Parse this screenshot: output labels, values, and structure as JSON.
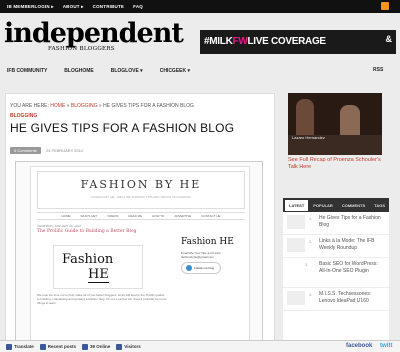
{
  "topbar": {
    "items": [
      "IB MEMBERLOGIN ▸",
      "ABOUT ▸",
      "CONTRIBUTE",
      "FAQ"
    ]
  },
  "logo": {
    "name": "independent",
    "tagline": "FASHION BLOGGERS"
  },
  "banner": {
    "hashtag_prefix": "#MILK",
    "hashtag_accent": "FW",
    "hashtag_rest": "LIVE COVERAGE",
    "brand": "&"
  },
  "mainnav": {
    "items": [
      "IFB COMMUNITY",
      "BLOGHOME",
      "BLOGLOVE ▾",
      "CHICGEEK ▾"
    ],
    "rss": "RSS"
  },
  "breadcrumb": {
    "prefix": "YOU ARE HERE:",
    "home": "HOME",
    "sep1": " » ",
    "blogging": "BLOGGING",
    "sep2": " » HE GIVES TIPS FOR A FASHION BLOG"
  },
  "category": "BLOGGING",
  "post": {
    "title": "HE GIVES TIPS FOR A FASHION BLOG",
    "comments": "6 Comments",
    "date": "24 FEBRUARY 2012"
  },
  "screenshot": {
    "blog_title": "FASHION BY HE",
    "blog_sub": "FASHION BY HE · WE'LL BE SHARING TIPS AND TRICKS ON FASHION",
    "menu": [
      "HOME",
      "WHO'S HE?",
      "VIDEOS",
      "READ ME",
      "HOW TO",
      "ADVERTISE",
      "CONTACT HE"
    ],
    "post_date": "THURSDAY, JANUARY 26, 2012",
    "post_title": "The Prolific Guide to Building a Better Blog",
    "logo_text": "Fashion",
    "logo_sub": "HE",
    "side_logo": "Fashion HE",
    "readme": "Email Me Your Tips and Links: fashionbyhe@gmail.com",
    "follow": "Follow me blog",
    "body": "We took the time out to help make all of you better bloggers. Links still lead to the Prolific guides to building, maintaining and growing a fashion blog. It's not a perfect list, there'll probably be more things to learn."
  },
  "sidebar": {
    "video_caption": "Lazaro Hernandez",
    "link": "See Full Recap of Proenza Schouler's Talk Here",
    "tabs": [
      "LATEST",
      "POPULAR",
      "COMMENTS",
      "TAGS"
    ],
    "items": [
      {
        "num": "1.",
        "text": "He Gives Tips for a Fashion Blog"
      },
      {
        "num": "2.",
        "text": "Links à la Mode: The IFB Weekly Roundup"
      },
      {
        "num": "3.",
        "text": "Basic SEO for WordPress: All-In-One SEO Plugin"
      },
      {
        "num": "4.",
        "text": "M.I.S.S. Techsessories: Lenovo IdeaPad U160"
      }
    ]
  },
  "statusbar": {
    "items": [
      "Translate",
      "Recent posts",
      "39 Online",
      "Visitors"
    ],
    "facebook": "facebook",
    "twitter": "twitt"
  }
}
